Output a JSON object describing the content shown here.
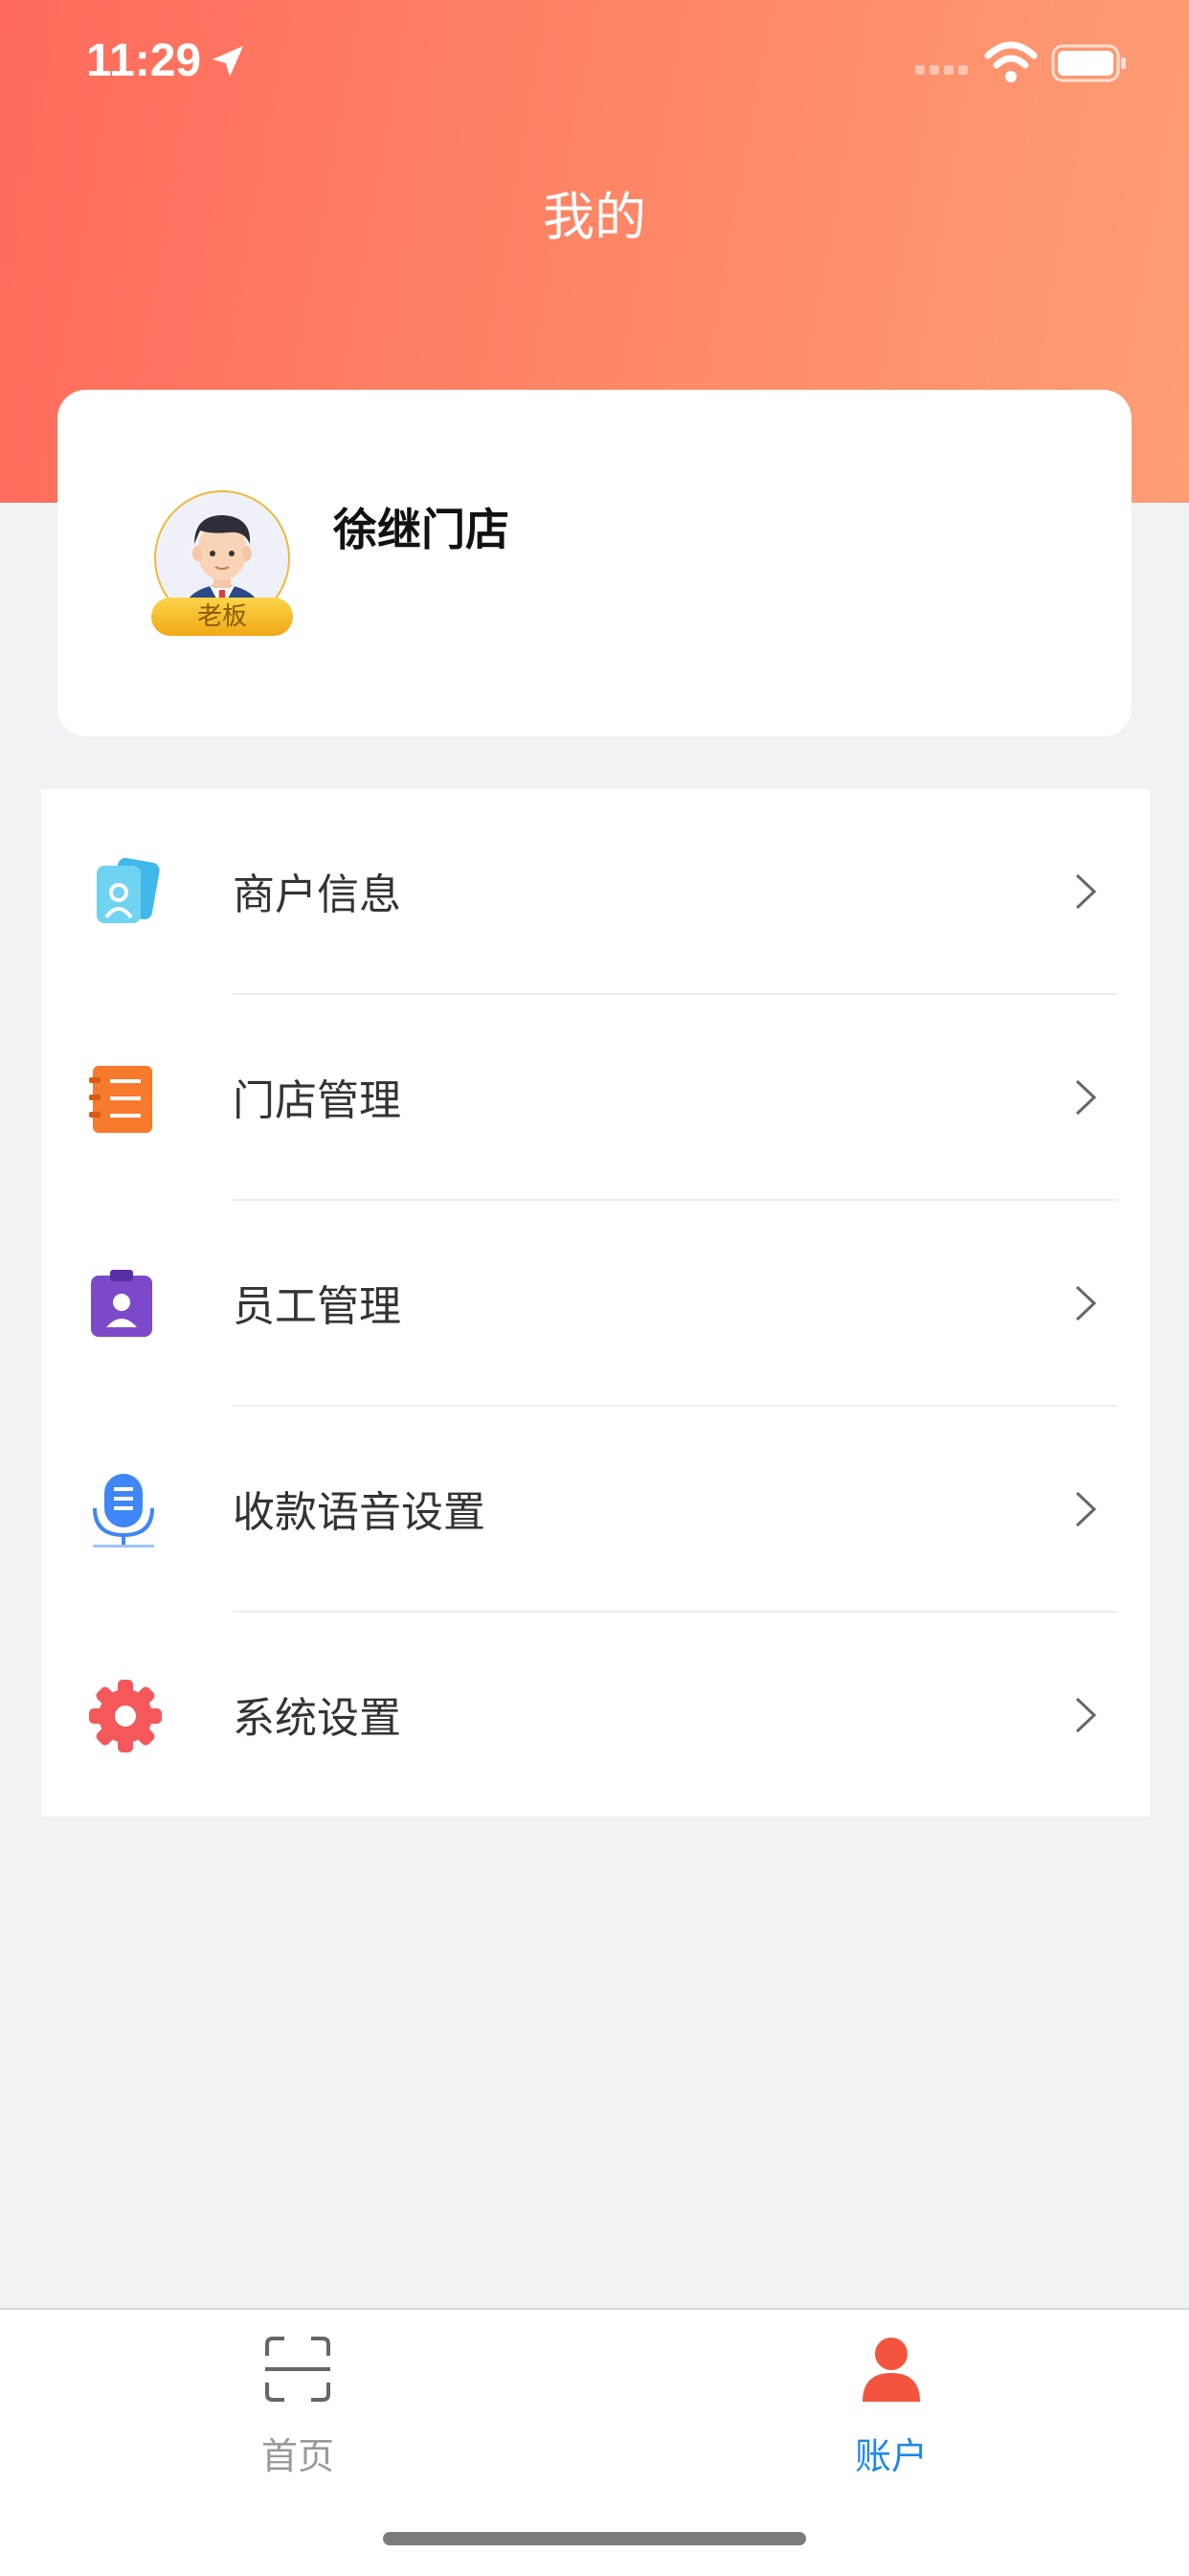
{
  "status_bar": {
    "time": "11:29",
    "icons": [
      "location-arrow-icon",
      "signal-icon",
      "wifi-icon",
      "battery-icon"
    ]
  },
  "header": {
    "title": "我的"
  },
  "profile": {
    "store_name": "徐继门店",
    "role_badge": "老板",
    "avatar_icon": "businessman-avatar"
  },
  "menu": {
    "items": [
      {
        "label": "商户信息",
        "icon": "merchant-card-icon",
        "color": "#4fc4ec"
      },
      {
        "label": "门店管理",
        "icon": "store-notebook-icon",
        "color": "#f77a2d"
      },
      {
        "label": "员工管理",
        "icon": "employee-badge-icon",
        "color": "#7b49c9"
      },
      {
        "label": "收款语音设置",
        "icon": "microphone-icon",
        "color": "#3f86f6"
      },
      {
        "label": "系统设置",
        "icon": "gear-icon",
        "color": "#f4585a"
      }
    ]
  },
  "tab_bar": {
    "tabs": [
      {
        "label": "首页",
        "icon": "scan-icon",
        "active": false
      },
      {
        "label": "账户",
        "icon": "user-icon",
        "active": true
      }
    ],
    "active_color": "#1e88e5",
    "inactive_color": "#999999"
  },
  "colors": {
    "header_gradient_start": "#ff6a5c",
    "header_gradient_end": "#fd9e75",
    "background": "#f1f2f6"
  }
}
